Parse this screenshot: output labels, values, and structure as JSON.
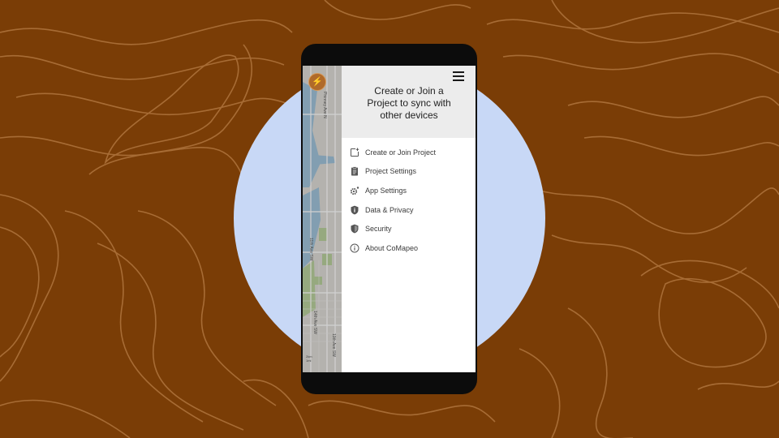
{
  "drawer": {
    "header_text": "Create or Join a Project to sync with other devices",
    "menu_button_icon": "hamburger-menu-icon",
    "items": [
      {
        "label": "Create or Join Project",
        "icon": "add-project-icon"
      },
      {
        "label": "Project Settings",
        "icon": "clipboard-icon"
      },
      {
        "label": "App Settings",
        "icon": "gear-icon"
      },
      {
        "label": "Data & Privacy",
        "icon": "shield-info-icon"
      },
      {
        "label": "Security",
        "icon": "shield-icon"
      },
      {
        "label": "About CoMapeo",
        "icon": "info-icon"
      }
    ]
  },
  "map": {
    "sync_icon": "lightning-icon",
    "streets": [
      "Phinney Ave N",
      "11th Ave SW",
      "14th Ave SW",
      "19th Ave SW"
    ],
    "scale_labels": [
      "2km",
      "1mi"
    ]
  },
  "colors": {
    "background": "#7a3d06",
    "circle": "#c8d8f6",
    "drawer_header": "#ececec"
  }
}
